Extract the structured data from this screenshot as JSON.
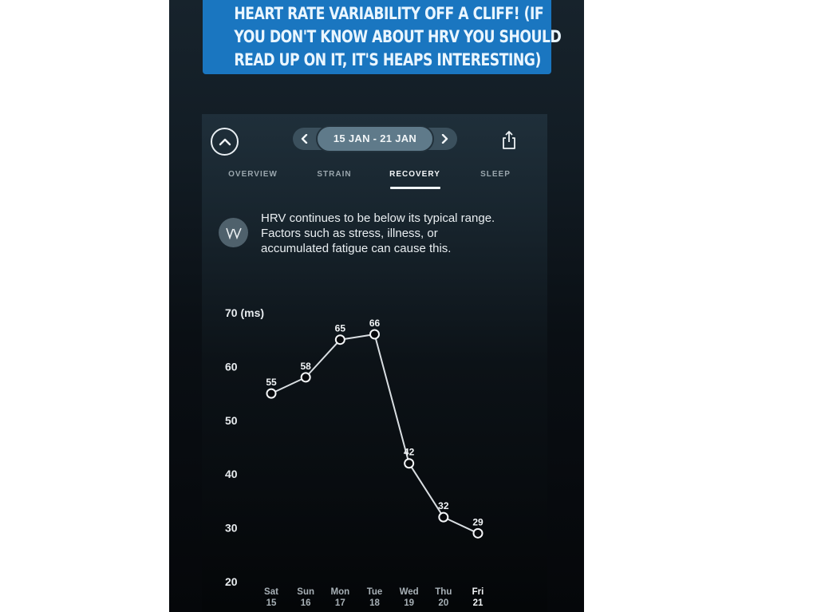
{
  "caption": {
    "lines": [
      "HEART RATE VARIABILITY OFF A CLIFF! (IF",
      "YOU DON'T KNOW ABOUT HRV YOU SHOULD",
      "READ UP ON IT, IT'S HEAPS INTERESTING)"
    ],
    "background_color": "#1a76c0"
  },
  "header": {
    "collapse_icon": "chevron-up-icon",
    "prev_icon": "chevron-left-icon",
    "next_icon": "chevron-right-icon",
    "date_range": "15 JAN - 21 JAN",
    "share_icon": "share-icon"
  },
  "tabs": [
    {
      "label": "OVERVIEW",
      "active": false
    },
    {
      "label": "STRAIN",
      "active": false
    },
    {
      "label": "RECOVERY",
      "active": true
    },
    {
      "label": "SLEEP",
      "active": false
    }
  ],
  "insight": {
    "icon": "whoop-logo-icon",
    "icon_text": "W",
    "lines": [
      "HRV continues to be below its typical range.",
      "Factors such as stress, illness, or",
      "accumulated fatigue can cause this."
    ]
  },
  "chart_data": {
    "type": "line",
    "title": "",
    "xlabel": "",
    "ylabel": "70 (ms)",
    "unit": "ms",
    "ylim": [
      20,
      70
    ],
    "yticks": [
      70,
      60,
      50,
      40,
      30,
      20
    ],
    "ytick_labels": [
      "70 (ms)",
      "60",
      "50",
      "40",
      "30",
      "20"
    ],
    "categories": [
      {
        "day": "Sat",
        "date": "15"
      },
      {
        "day": "Sun",
        "date": "16"
      },
      {
        "day": "Mon",
        "date": "17"
      },
      {
        "day": "Tue",
        "date": "18"
      },
      {
        "day": "Wed",
        "date": "19"
      },
      {
        "day": "Thu",
        "date": "20"
      },
      {
        "day": "Fri",
        "date": "21"
      }
    ],
    "highlighted_category": 6,
    "series": [
      {
        "name": "HRV",
        "values": [
          55,
          58,
          65,
          66,
          42,
          32,
          29
        ]
      }
    ],
    "data_labels": [
      "55",
      "58",
      "65",
      "66",
      "42",
      "32",
      "29"
    ],
    "grid": false,
    "legend": "none",
    "line_color": "#d9dee2",
    "marker": "hollow-circle"
  }
}
